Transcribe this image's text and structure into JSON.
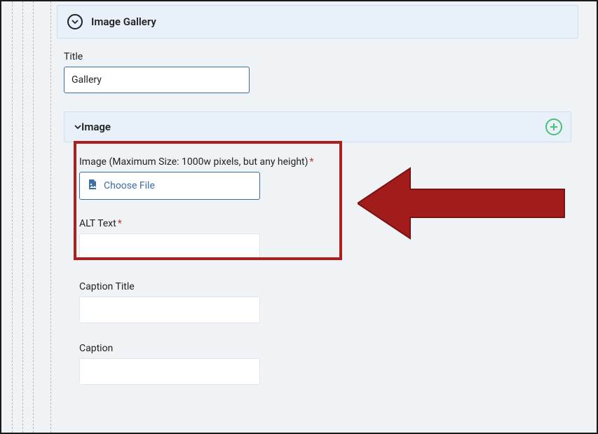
{
  "gallery_section": {
    "header": "Image Gallery",
    "title_label": "Title",
    "title_value": "Gallery"
  },
  "image_section": {
    "header": "Image",
    "image_label": "Image (Maximum Size: 1000w pixels, but any height)",
    "choose_file_label": "Choose File",
    "alt_text_label": "ALT Text",
    "alt_text_value": "",
    "caption_title_label": "Caption Title",
    "caption_title_value": "",
    "caption_label": "Caption",
    "caption_value": ""
  },
  "required_marker": "*"
}
